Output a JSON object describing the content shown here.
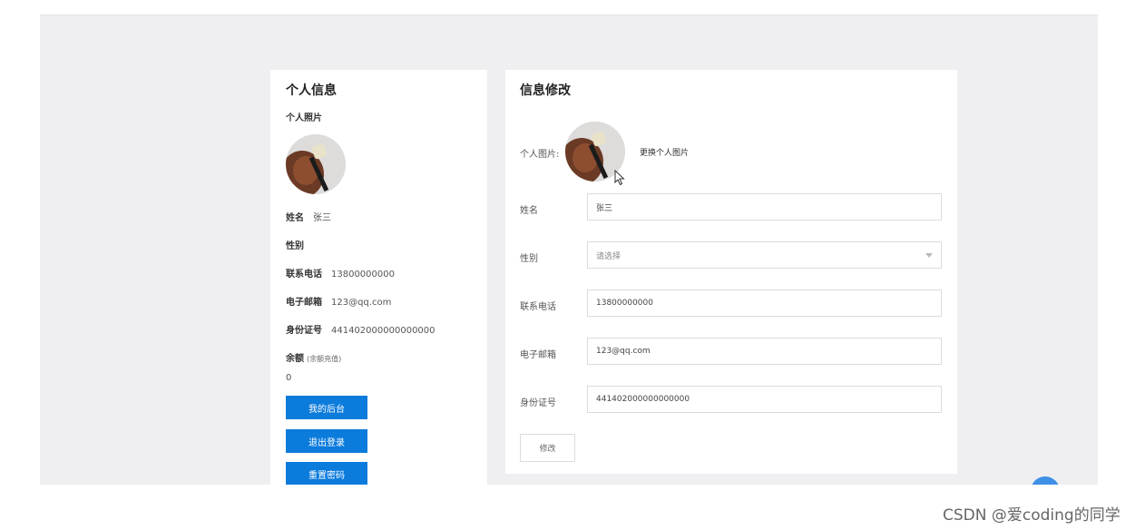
{
  "profile": {
    "title": "个人信息",
    "photo_label": "个人照片",
    "name_label": "姓名",
    "name_value": "张三",
    "gender_label": "性别",
    "gender_value": "",
    "phone_label": "联系电话",
    "phone_value": "13800000000",
    "email_label": "电子邮箱",
    "email_value": "123@qq.com",
    "id_label": "身份证号",
    "id_value": "441402000000000000",
    "balance_label": "余额",
    "balance_note": "(余额充值)",
    "balance_value": "0",
    "btn_dashboard": "我的后台",
    "btn_logout": "退出登录",
    "btn_reset_pwd": "重置密码"
  },
  "edit": {
    "title": "信息修改",
    "photo_label": "个人图片:",
    "change_photo": "更换个人图片",
    "name_label": "姓名",
    "name_value": "张三",
    "gender_label": "性别",
    "gender_placeholder": "请选择",
    "phone_label": "联系电话",
    "phone_value": "13800000000",
    "email_label": "电子邮箱",
    "email_value": "123@qq.com",
    "id_label": "身份证号",
    "id_value": "441402000000000000",
    "submit_label": "修改"
  },
  "icons": {
    "avatar": "avatar-photo",
    "cursor": "mouse-pointer-icon",
    "dropdown": "chevron-down-icon",
    "fab": "floating-action-button"
  },
  "colors": {
    "primary": "#0b7bdc",
    "stage_bg": "#efeff1",
    "fab": "#3e8fe6"
  },
  "watermark": "CSDN @爱coding的同学"
}
